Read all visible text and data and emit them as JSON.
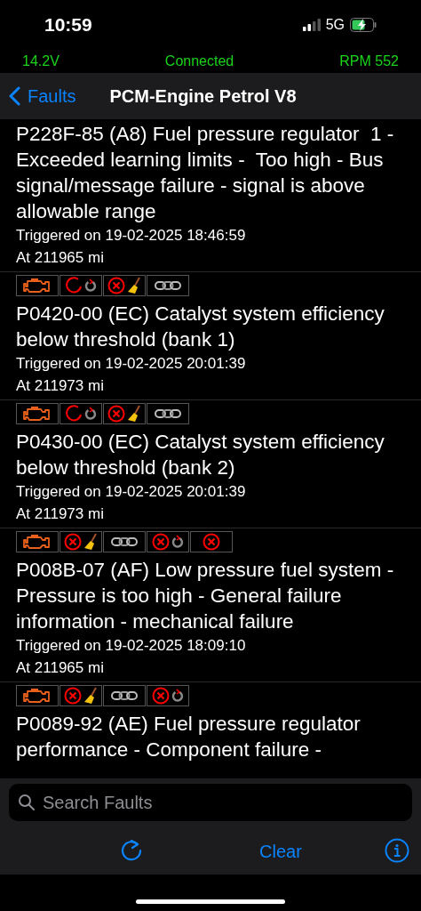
{
  "status_bar": {
    "time": "10:59",
    "network": "5G"
  },
  "info_bar": {
    "voltage": "14.2V",
    "connection": "Connected",
    "rpm": "RPM 552"
  },
  "nav_bar": {
    "back": "Faults",
    "title": "PCM-Engine Petrol V8"
  },
  "faults": [
    {
      "title": "P228F-85 (A8) Fuel pressure regulator  1 - Exceeded learning limits -  Too high - Bus signal/message failure - signal is above allowable range",
      "triggered": "Triggered on 19-02-2025 18:46:59",
      "mileage": "At 211965 mi"
    },
    {
      "icons": [
        {
          "kind": "engine"
        },
        {
          "kind": "pending"
        },
        {
          "kind": "cleared"
        },
        {
          "kind": "chain"
        }
      ],
      "title": "P0420-00 (EC) Catalyst system efficiency below threshold (bank 1)",
      "triggered": "Triggered on 19-02-2025 20:01:39",
      "mileage": "At 211973 mi"
    },
    {
      "icons": [
        {
          "kind": "engine"
        },
        {
          "kind": "pending"
        },
        {
          "kind": "cleared"
        },
        {
          "kind": "chain"
        }
      ],
      "title": "P0430-00 (EC) Catalyst system efficiency below threshold (bank 2)",
      "triggered": "Triggered on 19-02-2025 20:01:39",
      "mileage": "At 211973 mi"
    },
    {
      "icons": [
        {
          "kind": "engine"
        },
        {
          "kind": "cleared"
        },
        {
          "kind": "chain"
        },
        {
          "kind": "failed_cycle"
        },
        {
          "kind": "failed"
        }
      ],
      "title": "P008B-07 (AF) Low pressure fuel system - Pressure is too high - General failure information - mechanical failure",
      "triggered": "Triggered on 19-02-2025 18:09:10",
      "mileage": "At 211965 mi"
    },
    {
      "icons": [
        {
          "kind": "engine"
        },
        {
          "kind": "cleared"
        },
        {
          "kind": "chain"
        },
        {
          "kind": "failed_cycle"
        }
      ],
      "title": "P0089-92 (AE) Fuel pressure regulator performance - Component failure -"
    }
  ],
  "search": {
    "placeholder": "Search Faults"
  },
  "toolbar": {
    "clear": "Clear"
  }
}
